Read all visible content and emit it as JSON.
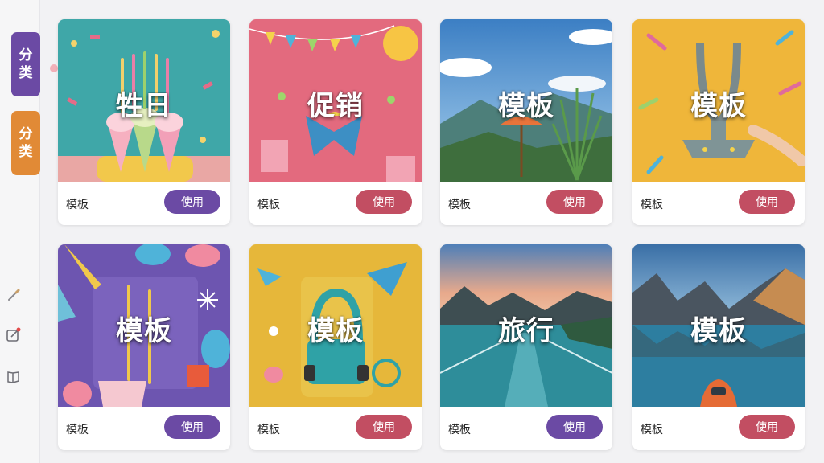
{
  "sidebar": {
    "tabs": [
      {
        "label": "分\n类",
        "color": "#6b4aa4"
      },
      {
        "label": "分\n类",
        "color": "#e18a36"
      }
    ],
    "tools": [
      "brush-icon",
      "edit-note-icon",
      "book-icon"
    ]
  },
  "colors": {
    "purple_button": "#6b4aa4",
    "red_button": "#c24e62"
  },
  "cards": [
    {
      "title": "牲日",
      "label": "模板",
      "button": "使用",
      "button_color": "#6b4aa4",
      "theme": "birthday-cake"
    },
    {
      "title": "促销",
      "label": "模板",
      "button": "使用",
      "button_color": "#c24e62",
      "theme": "sale-gifts"
    },
    {
      "title": "模板",
      "label": "模板",
      "button": "使用",
      "button_color": "#c24e62",
      "theme": "mountain-umbrella"
    },
    {
      "title": "模板",
      "label": "模板",
      "button": "使用",
      "button_color": "#c24e62",
      "theme": "trophy-yellow"
    },
    {
      "title": "模板",
      "label": "模板",
      "button": "使用",
      "button_color": "#6b4aa4",
      "theme": "party-purple"
    },
    {
      "title": "模板",
      "label": "模板",
      "button": "使用",
      "button_color": "#c24e62",
      "theme": "travel-yellow"
    },
    {
      "title": "旅行",
      "label": "模板",
      "button": "使用",
      "button_color": "#6b4aa4",
      "theme": "lake-dock"
    },
    {
      "title": "模板",
      "label": "模板",
      "button": "使用",
      "button_color": "#c24e62",
      "theme": "lake-kayak"
    }
  ]
}
